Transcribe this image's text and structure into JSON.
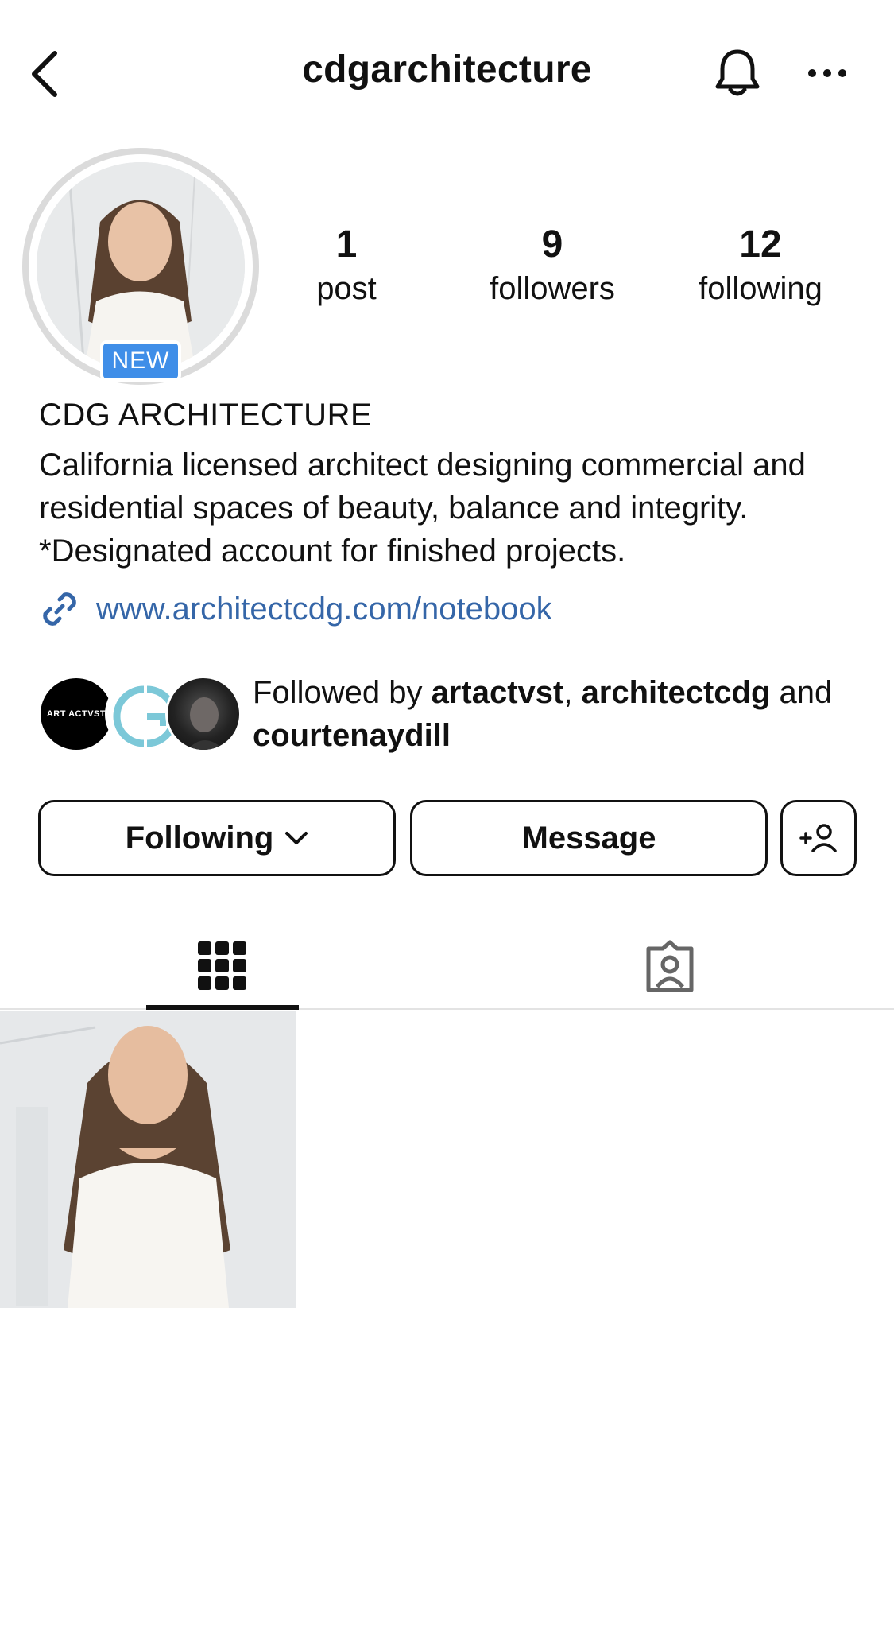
{
  "header": {
    "username": "cdgarchitecture"
  },
  "profile": {
    "badge": "NEW",
    "stats": [
      {
        "value": "1",
        "label": "post"
      },
      {
        "value": "9",
        "label": "followers"
      },
      {
        "value": "12",
        "label": "following"
      }
    ],
    "display_name": "CDG ARCHITECTURE",
    "bio": "California licensed architect designing commercial and residential spaces of beauty, balance and integrity. *Designated account for finished projects.",
    "link": "www.architectcdg.com/notebook"
  },
  "followed_by": {
    "prefix": "Followed by ",
    "user1": "artactvst",
    "sep": ", ",
    "user2": "architectcdg",
    "and": " and ",
    "user3": "courtenaydill",
    "avatar1_text": "ART ACTVST"
  },
  "actions": {
    "following_label": "Following",
    "message_label": "Message",
    "add_user_label": "+"
  },
  "tabs": {
    "grid_icon": "grid-icon",
    "tagged_icon": "tagged-icon"
  },
  "colors": {
    "link": "#3566a8",
    "badge": "#3f8ee8"
  }
}
